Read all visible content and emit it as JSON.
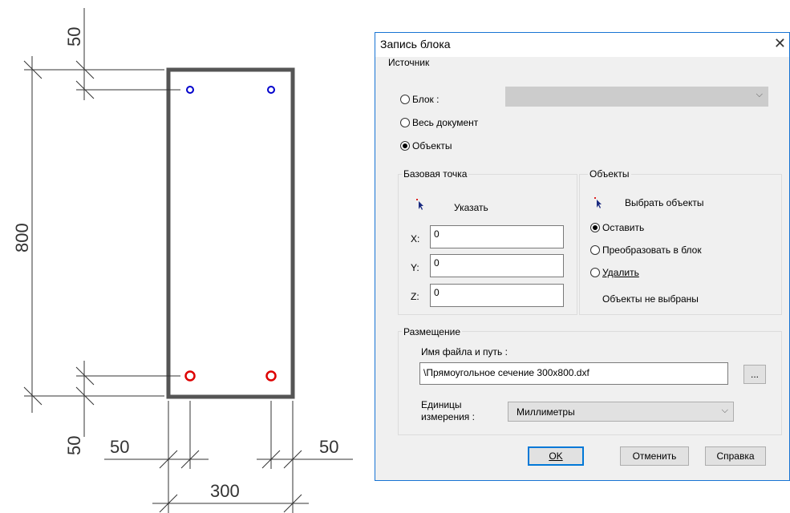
{
  "drawing": {
    "dims": {
      "top": "50",
      "height": "800",
      "bottom": "50",
      "left_inset": "50",
      "right_inset": "50",
      "width": "300"
    },
    "colors": {
      "outline": "#555555",
      "rebar_top": "#0000cc",
      "rebar_bottom": "#dd0000"
    }
  },
  "dialog": {
    "title": "Запись блока",
    "close_icon": "close-icon",
    "source": {
      "label": "Источник",
      "block_label": "Блок :",
      "block_value": "",
      "whole_doc_label": "Весь документ",
      "objects_label": "Объекты",
      "selected": "objects"
    },
    "base_point": {
      "label": "Базовая точка",
      "pick_label": "Указать",
      "x_label": "X:",
      "x_value": "0",
      "y_label": "Y:",
      "y_value": "0",
      "z_label": "Z:",
      "z_value": "0"
    },
    "objects": {
      "label": "Объекты",
      "select_label": "Выбрать объекты",
      "keep_label": "Оставить",
      "convert_label": "Преобразовать в блок",
      "delete_label": "Удалить",
      "selected": "keep",
      "status": "Объекты не выбраны"
    },
    "placement": {
      "label": "Размещение",
      "path_label": "Имя файла и путь :",
      "path_value": "\\Прямоугольное сечение 300x800.dxf",
      "browse_label": "...",
      "units_label_1": "Единицы",
      "units_label_2": "измерения :",
      "units_value": "Миллиметры"
    },
    "buttons": {
      "ok": "OK",
      "cancel": "Отменить",
      "help": "Справка"
    },
    "accent": "#0078d7"
  }
}
